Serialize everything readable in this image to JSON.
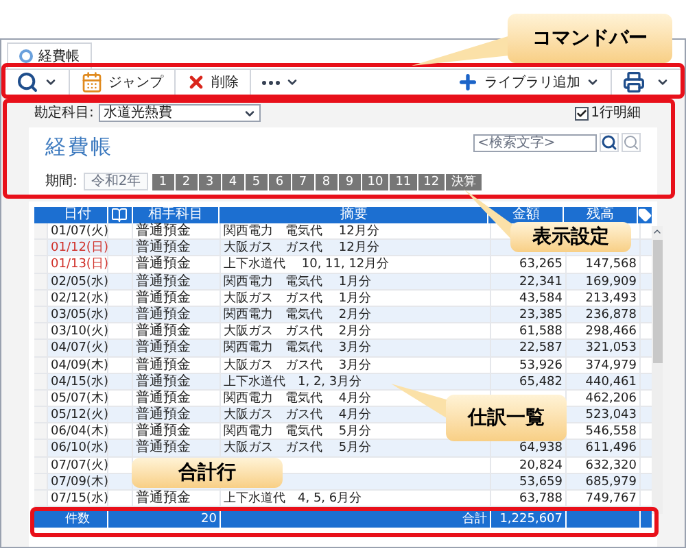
{
  "tab": {
    "title": "経費帳"
  },
  "toolbar": {
    "items": [
      {
        "kind": "search"
      },
      {
        "kind": "jump",
        "label": "ジャンプ"
      },
      {
        "kind": "delete",
        "label": "削除"
      },
      {
        "kind": "more"
      }
    ],
    "right": [
      {
        "kind": "add",
        "label": "ライブラリ追加"
      },
      {
        "kind": "print"
      }
    ]
  },
  "settings": {
    "account_label": "勘定科目:",
    "account_value": "水道光熱費",
    "one_line": {
      "label": "1行明細",
      "checked": true
    }
  },
  "ledger": {
    "title": "経費帳",
    "search": {
      "placeholder": "<検索文字>"
    },
    "period_label": "期間:",
    "year": "令和2年",
    "months": [
      "1",
      "2",
      "3",
      "4",
      "5",
      "6",
      "7",
      "8",
      "9",
      "10",
      "11",
      "12",
      "決算"
    ]
  },
  "table": {
    "columns": [
      "日付",
      "相手科目",
      "摘要",
      "金額",
      "残高"
    ],
    "rows": [
      {
        "date": "01/07(火)",
        "holiday": false,
        "account": "普通預金",
        "description": "関西電力　電気代　 12月分"
      },
      {
        "date": "01/12(日)",
        "holiday": true,
        "account": "普通預金",
        "description": "大阪ガス　ガス代　 12月分"
      },
      {
        "date": "01/13(日)",
        "holiday": true,
        "account": "普通預金",
        "description": "上下水道代　 10, 11, 12月分",
        "amount": "63,265",
        "balance": "147,568"
      },
      {
        "date": "02/05(水)",
        "holiday": false,
        "account": "普通預金",
        "description": "関西電力　電気代　 1月分",
        "amount": "22,341",
        "balance": "169,909"
      },
      {
        "date": "02/12(水)",
        "holiday": false,
        "account": "普通預金",
        "description": "大阪ガス　ガス代　 1月分",
        "amount": "43,584",
        "balance": "213,493"
      },
      {
        "date": "03/05(水)",
        "holiday": false,
        "account": "普通預金",
        "description": "関西電力　電気代　 2月分",
        "amount": "23,385",
        "balance": "236,878"
      },
      {
        "date": "03/10(火)",
        "holiday": false,
        "account": "普通預金",
        "description": "大阪ガス　ガス代　 2月分",
        "amount": "61,588",
        "balance": "298,466"
      },
      {
        "date": "04/07(火)",
        "holiday": false,
        "account": "普通預金",
        "description": "関西電力　電気代　 3月分",
        "amount": "22,587",
        "balance": "321,053"
      },
      {
        "date": "04/09(木)",
        "holiday": false,
        "account": "普通預金",
        "description": "大阪ガス　ガス代　 3月分",
        "amount": "53,926",
        "balance": "374,979"
      },
      {
        "date": "04/15(水)",
        "holiday": false,
        "account": "普通預金",
        "description": "上下水道代　1, 2, 3月分",
        "amount": "65,482",
        "balance": "440,461"
      },
      {
        "date": "05/07(木)",
        "holiday": false,
        "account": "普通預金",
        "description": "関西電力　電気代　 4月分",
        "balance": "462,206"
      },
      {
        "date": "05/12(火)",
        "holiday": false,
        "account": "普通預金",
        "description": "大阪ガス　ガス代　 4月分",
        "balance": "523,043"
      },
      {
        "date": "06/04(木)",
        "holiday": false,
        "account": "普通預金",
        "description": "関西電力　電気代　 5月分",
        "balance": "546,558"
      },
      {
        "date": "06/10(水)",
        "holiday": false,
        "account": "普通預金",
        "description": "大阪ガス　ガス代　 5月分",
        "amount": "64,938",
        "balance": "611,496"
      },
      {
        "date": "07/07(火)",
        "holiday": false,
        "amount": "20,824",
        "balance": "632,320"
      },
      {
        "date": "07/09(木)",
        "holiday": false,
        "amount": "53,659",
        "balance": "685,979"
      },
      {
        "date": "07/15(水)",
        "holiday": false,
        "account": "普通預金",
        "description": "上下水道代　4, 5, 6月分",
        "amount": "63,788",
        "balance": "749,767"
      }
    ],
    "total": {
      "count_label": "件数",
      "count": "20",
      "sum_label": "合計",
      "sum": "1,225,607"
    }
  },
  "callouts": [
    {
      "kind": "command",
      "text": "コマンドバー"
    },
    {
      "kind": "display",
      "text": "表示設定"
    },
    {
      "kind": "journal",
      "text": "仕訳一覧"
    },
    {
      "kind": "total",
      "text": "合計行"
    }
  ]
}
